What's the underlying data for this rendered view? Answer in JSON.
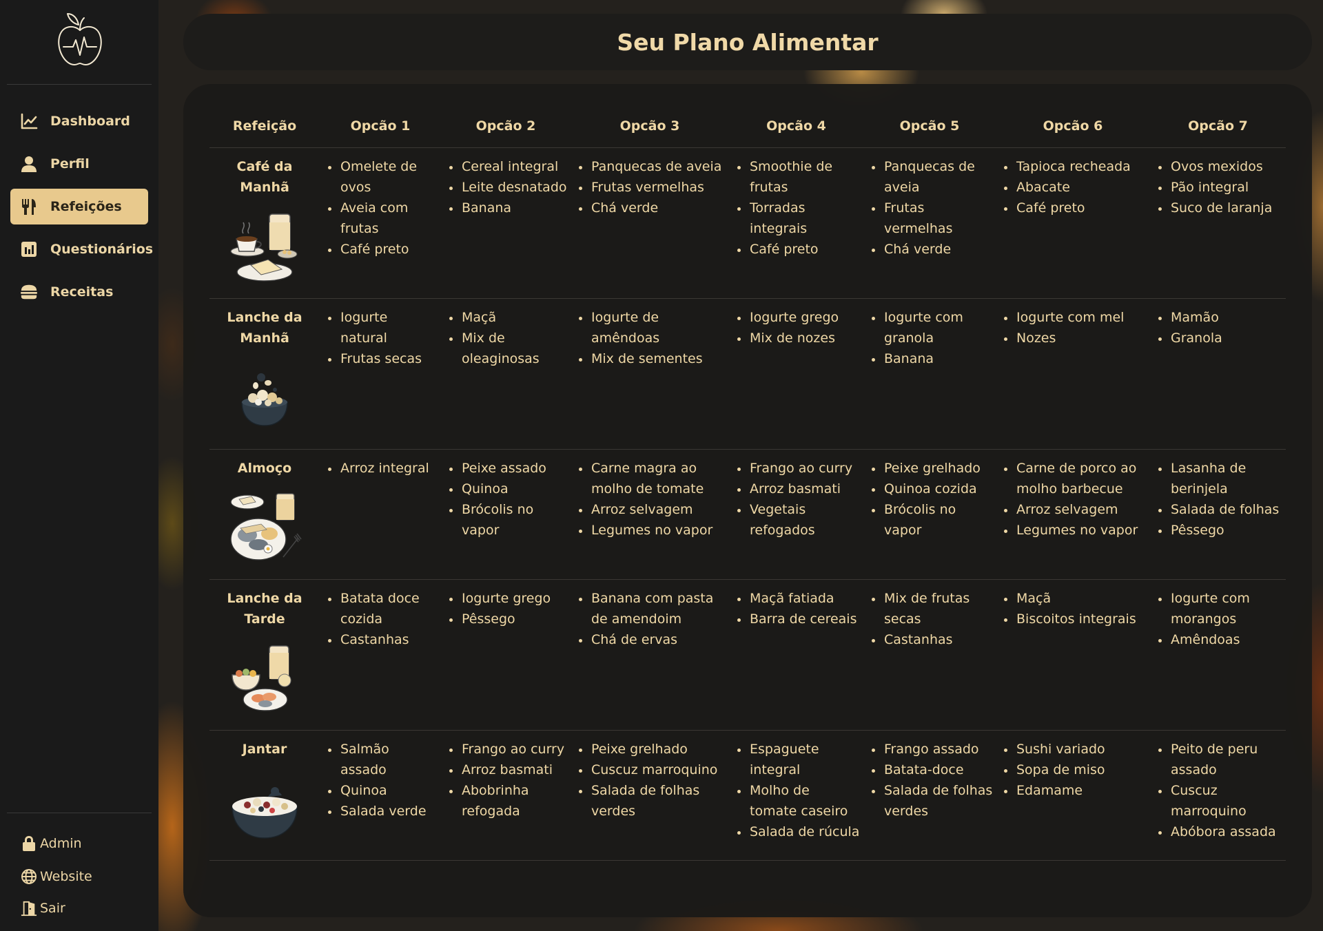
{
  "page_title": "Seu Plano Alimentar",
  "sidebar": {
    "nav": [
      {
        "label": "Dashboard",
        "icon": "chart-line-icon"
      },
      {
        "label": "Perfil",
        "icon": "user-icon"
      },
      {
        "label": "Refeições",
        "icon": "utensils-icon",
        "active": true
      },
      {
        "label": "Questionários",
        "icon": "bar-chart-icon"
      },
      {
        "label": "Receitas",
        "icon": "burger-icon"
      }
    ],
    "footer": [
      {
        "label": "Admin",
        "icon": "lock-icon"
      },
      {
        "label": "Website",
        "icon": "globe-icon"
      },
      {
        "label": "Sair",
        "icon": "door-exit-icon"
      }
    ]
  },
  "table": {
    "headers": [
      "Refeição",
      "Opcão 1",
      "Opcão 2",
      "Opcão 3",
      "Opcão 4",
      "Opcão 5",
      "Opcão 6",
      "Opcão 7"
    ],
    "rows": [
      {
        "meal": "Café da Manhã",
        "image": "breakfast-illustration",
        "options": [
          [
            "Omelete de ovos",
            "Aveia com frutas",
            "Café preto"
          ],
          [
            "Cereal integral",
            "Leite desnatado",
            "Banana"
          ],
          [
            "Panquecas de aveia",
            "Frutas vermelhas",
            "Chá verde"
          ],
          [
            "Smoothie de frutas",
            "Torradas integrais",
            "Café preto"
          ],
          [
            "Panquecas de aveia",
            "Frutas vermelhas",
            "Chá verde"
          ],
          [
            "Tapioca recheada",
            "Abacate",
            "Café preto"
          ],
          [
            "Ovos mexidos",
            "Pão integral",
            "Suco de laranja"
          ]
        ]
      },
      {
        "meal": "Lanche da Manhã",
        "image": "morning-snack-illustration",
        "options": [
          [
            "Iogurte natural",
            "Frutas secas"
          ],
          [
            "Maçã",
            "Mix de oleaginosas"
          ],
          [
            "Iogurte de amêndoas",
            "Mix de sementes"
          ],
          [
            "Iogurte grego",
            "Mix de nozes"
          ],
          [
            "Iogurte com granola",
            "Banana"
          ],
          [
            "Iogurte com mel",
            "Nozes"
          ],
          [
            "Mamão",
            "Granola"
          ]
        ]
      },
      {
        "meal": "Almoço",
        "image": "lunch-illustration",
        "options": [
          [
            "Arroz integral"
          ],
          [
            "Peixe assado",
            "Quinoa",
            "Brócolis no vapor"
          ],
          [
            "Carne magra ao molho de tomate",
            "Arroz selvagem",
            "Legumes no vapor"
          ],
          [
            "Frango ao curry",
            "Arroz basmati",
            "Vegetais refogados"
          ],
          [
            "Peixe grelhado",
            "Quinoa cozida",
            "Brócolis no vapor"
          ],
          [
            "Carne de porco ao molho barbecue",
            "Arroz selvagem",
            "Legumes no vapor"
          ],
          [
            "Lasanha de berinjela",
            "Salada de folhas",
            "Pêssego"
          ]
        ]
      },
      {
        "meal": "Lanche da Tarde",
        "image": "afternoon-snack-illustration",
        "options": [
          [
            "Batata doce cozida",
            "Castanhas"
          ],
          [
            "Iogurte grego",
            "Pêssego"
          ],
          [
            "Banana com pasta de amendoim",
            "Chá de ervas"
          ],
          [
            "Maçã fatiada",
            "Barra de cereais"
          ],
          [
            "Mix de frutas secas",
            "Castanhas"
          ],
          [
            "Maçã",
            "Biscoitos integrais"
          ],
          [
            "Iogurte com morangos",
            "Amêndoas"
          ]
        ]
      },
      {
        "meal": "Jantar",
        "image": "dinner-illustration",
        "options": [
          [
            "Salmão assado",
            "Quinoa",
            "Salada verde"
          ],
          [
            "Frango ao curry",
            "Arroz basmati",
            "Abobrinha refogada"
          ],
          [
            "Peixe grelhado",
            "Cuscuz marroquino",
            "Salada de folhas verdes"
          ],
          [
            "Espaguete integral",
            "Molho de tomate caseiro",
            "Salada de rúcula"
          ],
          [
            "Frango assado",
            "Batata-doce",
            "Salada de folhas verdes"
          ],
          [
            "Sushi variado",
            "Sopa de miso",
            "Edamame"
          ],
          [
            "Peito de peru assado",
            "Cuscuz marroquino",
            "Abóbora assada"
          ]
        ]
      }
    ]
  },
  "colors": {
    "accent": "#e8c98d",
    "text": "#efd8a6",
    "sidebar_bg": "#1a1a1a",
    "card_bg": "#1b1a18"
  }
}
